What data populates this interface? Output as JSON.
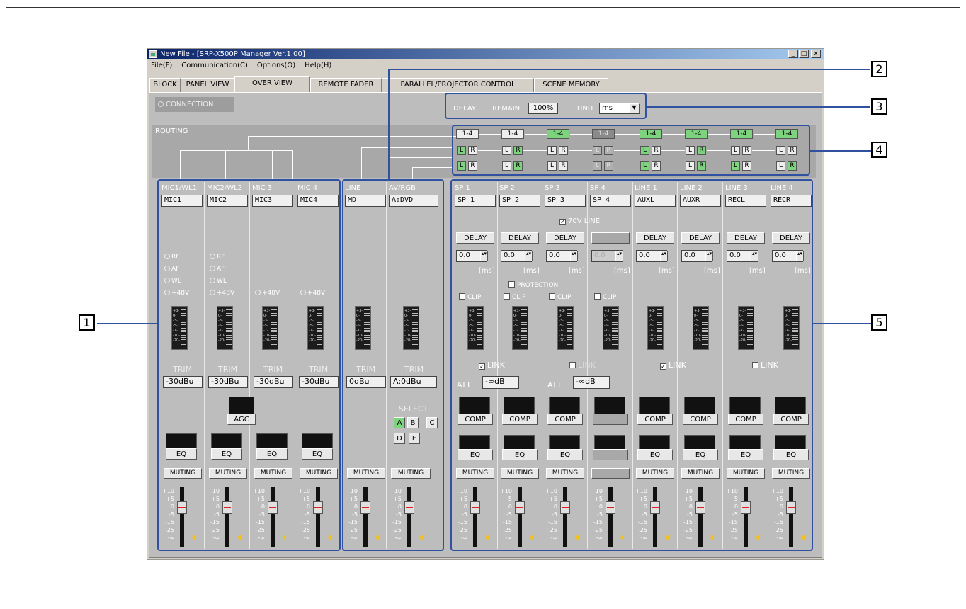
{
  "window": {
    "title": "New File - [SRP-X500P Manager Ver.1.00]",
    "min": "_",
    "max": "□",
    "close": "×"
  },
  "menu": [
    "File(F)",
    "Communication(C)",
    "Options(O)",
    "Help(H)"
  ],
  "tabs": [
    "BLOCK",
    "PANEL VIEW",
    "OVER VIEW",
    "REMOTE FADER",
    "PARALLEL/PROJECTOR CONTROL",
    "SCENE MEMORY"
  ],
  "active_tab": "OVER VIEW",
  "connection": "CONNECTION",
  "delay": {
    "label": "DELAY",
    "remain_label": "REMAIN",
    "remain": "100%",
    "unit_label": "UNIT",
    "unit": "ms"
  },
  "routing_label": "ROUTING",
  "route_btn": "1-4",
  "L": "L",
  "R": "R",
  "inputs": [
    {
      "name": "MIC1/WL1",
      "box": "MIC1",
      "leds": [
        "RF",
        "AF",
        "WL",
        "+48V"
      ],
      "trim": "-30dBu"
    },
    {
      "name": "MIC2/WL2",
      "box": "MIC2",
      "leds": [
        "RF",
        "AF",
        "WL",
        "+48V"
      ],
      "trim": "-30dBu"
    },
    {
      "name": "MIC 3",
      "box": "MIC3",
      "leds": [
        "+48V"
      ],
      "trim": "-30dBu"
    },
    {
      "name": "MIC 4",
      "box": "MIC4",
      "leds": [
        "+48V"
      ],
      "trim": "-30dBu"
    },
    {
      "name": "LINE",
      "box": "MD",
      "leds": [],
      "trim": "0dBu"
    },
    {
      "name": "AV/RGB",
      "box": "A:DVD",
      "leds": [],
      "trim": "A:0dBu"
    }
  ],
  "outputs": [
    {
      "name": "SP 1",
      "box": "SP 1",
      "delay": "0.0"
    },
    {
      "name": "SP 2",
      "box": "SP 2",
      "delay": "0.0"
    },
    {
      "name": "SP 3",
      "box": "SP 3",
      "delay": "0.0"
    },
    {
      "name": "SP 4",
      "box": "SP 4",
      "delay": "0.0"
    },
    {
      "name": "LINE 1",
      "box": "AUXL",
      "delay": "0.0"
    },
    {
      "name": "LINE 2",
      "box": "AUXR",
      "delay": "0.0"
    },
    {
      "name": "LINE 3",
      "box": "RECL",
      "delay": "0.0"
    },
    {
      "name": "LINE 4",
      "box": "RECR",
      "delay": "0.0"
    }
  ],
  "labels": {
    "trim": "TRIM",
    "agc": "AGC",
    "eq": "EQ",
    "muting": "MUTING",
    "comp": "COMP",
    "delay_btn": "DELAY",
    "ms": "[ms]",
    "clip": "CLIP",
    "link": "LINK",
    "att": "ATT",
    "att_val": "-∞dB",
    "protection": "PROTECTION",
    "v70": "70V LINE",
    "select": "SELECT"
  },
  "select": [
    "A",
    "B",
    "C",
    "D",
    "E"
  ],
  "meter_scale": [
    "+3-",
    "0-",
    "-3-",
    "-5-",
    "-7-",
    "-10-",
    "-20-"
  ],
  "fader_scale": [
    "+10",
    "+5",
    "0",
    "-5",
    "-15",
    "-25",
    "-∞"
  ],
  "callouts": [
    "1",
    "2",
    "3",
    "4",
    "5"
  ]
}
